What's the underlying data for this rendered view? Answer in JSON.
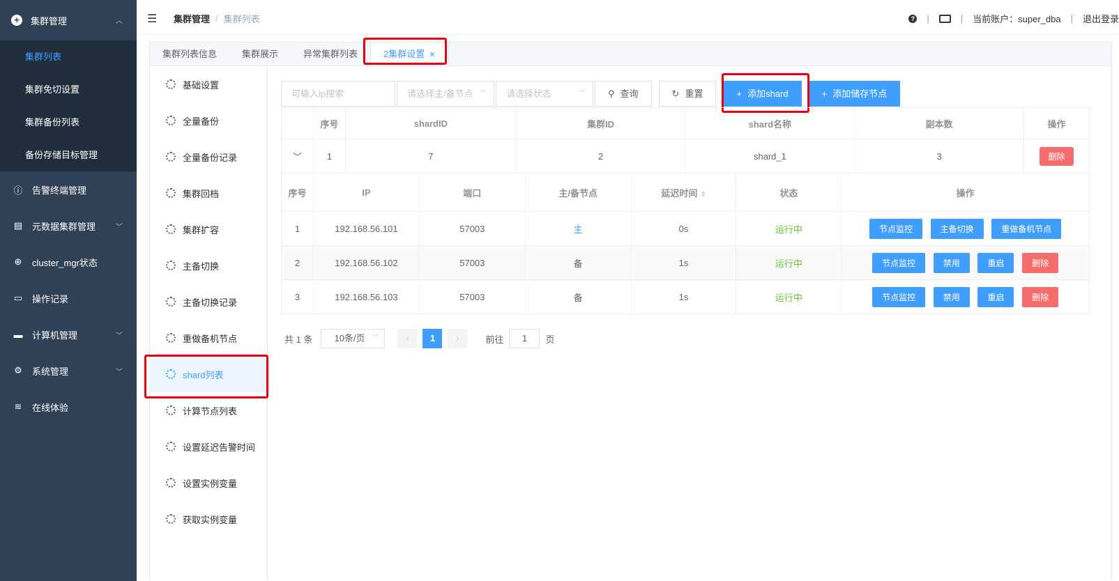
{
  "sidebar": {
    "head": {
      "label": "集群管理"
    },
    "sub_items": [
      "集群列表",
      "集群免切设置",
      "集群备份列表",
      "备份存储目标管理"
    ],
    "items": [
      {
        "label": "告警终端管理",
        "icon": "alert-icon",
        "chev": false
      },
      {
        "label": "元数据集群管理",
        "icon": "metadata-icon",
        "chev": true
      },
      {
        "label": "cluster_mgr状态",
        "icon": "status-icon",
        "chev": false
      },
      {
        "label": "操作记录",
        "icon": "record-icon",
        "chev": false
      },
      {
        "label": "计算机管理",
        "icon": "computer-icon",
        "chev": true
      },
      {
        "label": "系统管理",
        "icon": "settings-icon",
        "chev": true
      },
      {
        "label": "在线体验",
        "icon": "database-icon",
        "chev": false
      }
    ]
  },
  "header": {
    "breadcrumb1": "集群管理",
    "breadcrumb2": "集群列表",
    "account": "当前账户：super_dba",
    "logout": "退出登录"
  },
  "tabs": [
    "集群列表信息",
    "集群展示",
    "异常集群列表",
    "2集群设置"
  ],
  "menu": [
    "基础设置",
    "全量备份",
    "全量备份记录",
    "集群回档",
    "集群扩容",
    "主备切换",
    "主备切换记录",
    "重做备机节点",
    "shard列表",
    "计算节点列表",
    "设置延迟告警时间",
    "设置实例变量",
    "获取实例变量"
  ],
  "toolbar": {
    "ip_placeholder": "可输入ip搜索",
    "role_placeholder": "请选择主/备节点",
    "state_placeholder": "请选择状态",
    "query": "查询",
    "reset": "重置",
    "add_shard": "添加shard",
    "add_storage": "添加储存节点"
  },
  "shard_table": {
    "headers": [
      "序号",
      "shardID",
      "集群ID",
      "shard名称",
      "副本数",
      "操作"
    ],
    "row": [
      "1",
      "7",
      "2",
      "shard_1",
      "3"
    ],
    "delete": "删除"
  },
  "node_table": {
    "headers": [
      "序号",
      "IP",
      "端口",
      "主/备节点",
      "延迟时间",
      "状态",
      "操作"
    ],
    "rows": [
      {
        "no": "1",
        "ip": "192.168.56.101",
        "port": "57003",
        "role": "主",
        "delay": "0s",
        "state": "运行中",
        "actions": [
          "节点监控",
          "主备切换",
          "重做备机节点"
        ]
      },
      {
        "no": "2",
        "ip": "192.168.56.102",
        "port": "57003",
        "role": "备",
        "delay": "1s",
        "state": "运行中",
        "actions": [
          "节点监控",
          "禁用",
          "重启",
          "删除"
        ]
      },
      {
        "no": "3",
        "ip": "192.168.56.103",
        "port": "57003",
        "role": "备",
        "delay": "1s",
        "state": "运行中",
        "actions": [
          "节点监控",
          "禁用",
          "重启",
          "删除"
        ]
      }
    ]
  },
  "pager": {
    "total": "共 1 条",
    "size": "10条/页",
    "page": "1",
    "goto": "前往",
    "goto_value": "1",
    "page_unit": "页"
  }
}
